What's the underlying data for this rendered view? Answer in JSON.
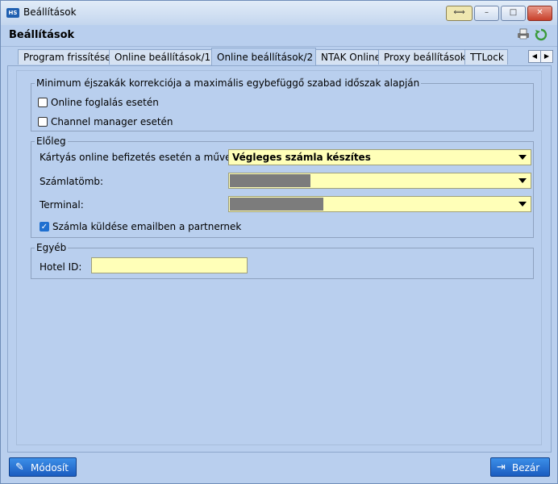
{
  "window": {
    "app_icon": "HS",
    "title": "Beállítások",
    "buttons": {
      "move": "move-icon",
      "minimize": "–",
      "maximize": "□",
      "close": "✕"
    }
  },
  "header": {
    "title": "Beállítások",
    "icons": [
      "print-icon",
      "refresh-icon"
    ]
  },
  "tabs": [
    {
      "label": "Program frissítése",
      "active": false
    },
    {
      "label": "Online beállítások/1",
      "active": false
    },
    {
      "label": "Online beállítások/2",
      "active": true
    },
    {
      "label": "NTAK Online",
      "active": false
    },
    {
      "label": "Proxy beállítások",
      "active": false
    },
    {
      "label": "TTLock",
      "active": false
    }
  ],
  "groups": {
    "minimum": {
      "legend": "Minimum éjszakák korrekciója a maximális egybefüggő szabad időszak alapján",
      "checkboxes": [
        {
          "label": "Online foglalás esetén",
          "checked": false
        },
        {
          "label": "Channel manager esetén",
          "checked": false
        }
      ]
    },
    "eloleg": {
      "legend": "Előleg",
      "card_action_label": "Kártyás online befizetés esetén a művelet:",
      "card_action_value": "Végleges számla készítes",
      "szamlatomb_label": "Számlatömb:",
      "terminal_label": "Terminal:",
      "send_email": {
        "label": "Számla küldése emailben a partnernek",
        "checked": true
      }
    },
    "egyeb": {
      "legend": "Egyéb",
      "hotel_id_label": "Hotel ID:",
      "hotel_id_value": ""
    }
  },
  "footer": {
    "modify_label": "Módosít",
    "close_label": "Bezár"
  },
  "colors": {
    "background": "#b9cfee",
    "field": "#ffffb8",
    "button": "#1b5cc0"
  }
}
